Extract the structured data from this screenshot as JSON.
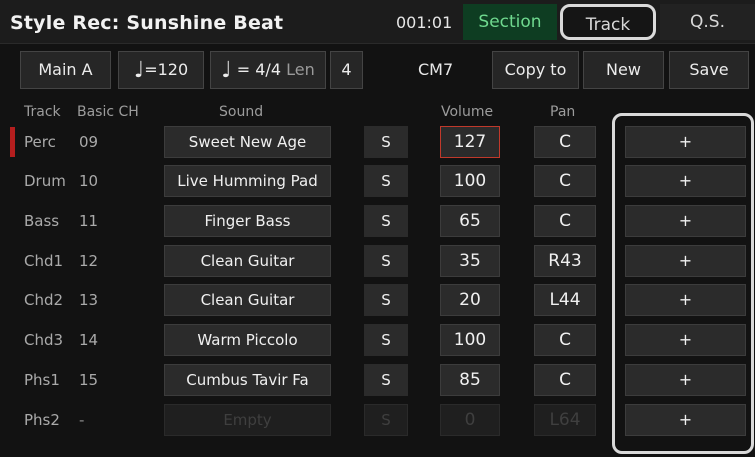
{
  "header": {
    "title": "Style Rec: Sunshine Beat",
    "time": "001:01",
    "tabs": {
      "section": "Section",
      "track": "Track",
      "qs": "Q.S."
    }
  },
  "toolbar": {
    "main": "Main A",
    "tempo_icon": "quarter-note-icon",
    "tempo": "=120",
    "beat_icon": "quarter-note-icon",
    "beat": "= 4/4",
    "len_label": "Len",
    "len_value": "4",
    "chord": "CM7",
    "copy": "Copy to",
    "new": "New",
    "save": "Save"
  },
  "columns": {
    "track": "Track",
    "basic_ch": "Basic CH",
    "sound": "Sound",
    "volume": "Volume",
    "pan": "Pan"
  },
  "rows": [
    {
      "track": "Perc",
      "ch": "09",
      "sound": "Sweet New Age",
      "s": "S",
      "volume": "127",
      "pan": "C",
      "plus": "+"
    },
    {
      "track": "Drum",
      "ch": "10",
      "sound": "Live Humming Pad",
      "s": "S",
      "volume": "100",
      "pan": "C",
      "plus": "+"
    },
    {
      "track": "Bass",
      "ch": "11",
      "sound": "Finger Bass",
      "s": "S",
      "volume": "65",
      "pan": "C",
      "plus": "+"
    },
    {
      "track": "Chd1",
      "ch": "12",
      "sound": "Clean Guitar",
      "s": "S",
      "volume": "35",
      "pan": "R43",
      "plus": "+"
    },
    {
      "track": "Chd2",
      "ch": "13",
      "sound": "Clean Guitar",
      "s": "S",
      "volume": "20",
      "pan": "L44",
      "plus": "+"
    },
    {
      "track": "Chd3",
      "ch": "14",
      "sound": "Warm Piccolo",
      "s": "S",
      "volume": "100",
      "pan": "C",
      "plus": "+"
    },
    {
      "track": "Phs1",
      "ch": "15",
      "sound": "Cumbus Tavir Fa",
      "s": "S",
      "volume": "85",
      "pan": "C",
      "plus": "+"
    },
    {
      "track": "Phs2",
      "ch": "-",
      "sound": "Empty",
      "s": "S",
      "volume": "0",
      "pan": "L64",
      "plus": "+"
    }
  ]
}
